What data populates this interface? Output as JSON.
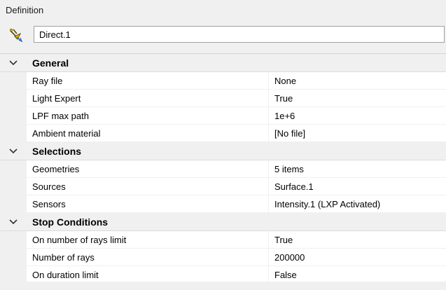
{
  "panel": {
    "title": "Definition"
  },
  "name_field": {
    "icon": "direct-simulation-icon",
    "value": "Direct.1"
  },
  "colors": {
    "panel_bg": "#f0f0f0",
    "grid_bg": "#ffffff",
    "icon_yellow": "#f2c200",
    "icon_stroke": "#5a4a00"
  },
  "categories": [
    {
      "label": "General",
      "expanded": true,
      "properties": [
        {
          "name": "Ray file",
          "value": "None"
        },
        {
          "name": "Light Expert",
          "value": "True"
        },
        {
          "name": "LPF max path",
          "value": "1e+6"
        },
        {
          "name": "Ambient material",
          "value": "[No file]"
        }
      ]
    },
    {
      "label": "Selections",
      "expanded": true,
      "properties": [
        {
          "name": "Geometries",
          "value": "5 items"
        },
        {
          "name": "Sources",
          "value": "Surface.1"
        },
        {
          "name": "Sensors",
          "value": "Intensity.1 (LXP Activated)"
        }
      ]
    },
    {
      "label": "Stop Conditions",
      "expanded": true,
      "properties": [
        {
          "name": "On number of rays limit",
          "value": "True"
        },
        {
          "name": "Number of rays",
          "value": "200000"
        },
        {
          "name": "On duration limit",
          "value": "False"
        }
      ]
    }
  ]
}
